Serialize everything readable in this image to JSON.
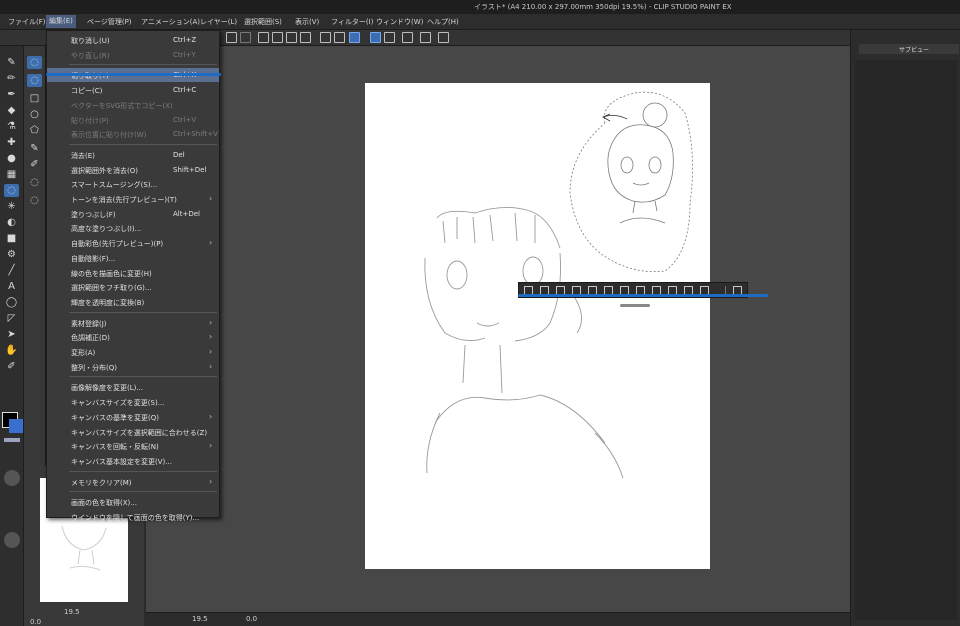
{
  "window": {
    "title": "イラスト* (A4 210.00 x 297.00mm 350dpi 19.5%) - CLIP STUDIO PAINT EX"
  },
  "menubar": {
    "items": [
      "ファイル(F)",
      "編集(E)",
      "ページ管理(P)",
      "アニメーション(A)",
      "レイヤー(L)",
      "選択範囲(S)",
      "表示(V)",
      "フィルター(I)",
      "ウィンドウ(W)",
      "ヘルプ(H)"
    ],
    "active": "編集(E)"
  },
  "edit_menu": {
    "items": [
      {
        "label": "取り消し(U)",
        "shortcut": "Ctrl+Z",
        "enabled": true
      },
      {
        "label": "やり直し(R)",
        "shortcut": "Ctrl+Y",
        "enabled": false
      },
      {
        "label": "切り取り(T)",
        "shortcut": "Ctrl+X",
        "enabled": true,
        "highlighted": true
      },
      {
        "label": "コピー(C)",
        "shortcut": "Ctrl+C",
        "enabled": true
      },
      {
        "label": "ベクターをSVG形式でコピー(X)",
        "shortcut": "",
        "enabled": false
      },
      {
        "label": "貼り付け(P)",
        "shortcut": "Ctrl+V",
        "enabled": false
      },
      {
        "label": "表示位置に貼り付け(W)",
        "shortcut": "Ctrl+Shift+V",
        "enabled": false
      },
      {
        "label": "消去(E)",
        "shortcut": "Del",
        "enabled": true
      },
      {
        "label": "選択範囲外を消去(O)",
        "shortcut": "Shift+Del",
        "enabled": true
      },
      {
        "label": "スマートスムージング(S)...",
        "shortcut": "",
        "enabled": true
      },
      {
        "label": "トーンを消去(先行プレビュー)(T)",
        "shortcut": "",
        "enabled": true,
        "submenu": true
      },
      {
        "label": "塗りつぶし(F)",
        "shortcut": "Alt+Del",
        "enabled": true
      },
      {
        "label": "高度な塗りつぶし(I)...",
        "shortcut": "",
        "enabled": true
      },
      {
        "label": "自動彩色(先行プレビュー)(P)",
        "shortcut": "",
        "enabled": true,
        "submenu": true
      },
      {
        "label": "自動陰影(F)...",
        "shortcut": "",
        "enabled": true
      },
      {
        "label": "線の色を描画色に変更(H)",
        "shortcut": "",
        "enabled": true
      },
      {
        "label": "選択範囲をフチ取り(G)...",
        "shortcut": "",
        "enabled": true
      },
      {
        "label": "輝度を透明度に変換(B)",
        "shortcut": "",
        "enabled": true
      },
      {
        "label": "素材登録(J)",
        "shortcut": "",
        "enabled": true,
        "submenu": true
      },
      {
        "label": "色調補正(D)",
        "shortcut": "",
        "enabled": true,
        "submenu": true
      },
      {
        "label": "変形(A)",
        "shortcut": "",
        "enabled": true,
        "submenu": true
      },
      {
        "label": "整列・分布(Q)",
        "shortcut": "",
        "enabled": true,
        "submenu": true
      },
      {
        "label": "画像解像度を変更(L)...",
        "shortcut": "",
        "enabled": true
      },
      {
        "label": "キャンバスサイズを変更(S)...",
        "shortcut": "",
        "enabled": true
      },
      {
        "label": "キャンバスの基準を変更(Q)",
        "shortcut": "",
        "enabled": true,
        "submenu": true
      },
      {
        "label": "キャンバスサイズを選択範囲に合わせる(Z)",
        "shortcut": "",
        "enabled": true
      },
      {
        "label": "キャンバスを回転・反転(N)",
        "shortcut": "",
        "enabled": true,
        "submenu": true
      },
      {
        "label": "キャンバス基本設定を変更(V)...",
        "shortcut": "",
        "enabled": true
      },
      {
        "label": "メモリをクリア(M)",
        "shortcut": "",
        "enabled": true,
        "submenu": true
      },
      {
        "label": "画面の色を取得(X)...",
        "shortcut": "",
        "enabled": true
      },
      {
        "label": "ウインドウを隠して画面の色を取得(Y)...",
        "shortcut": "",
        "enabled": true
      }
    ]
  },
  "statusbar": {
    "zoom": "19.5",
    "rotation": "0.0",
    "nav_zoom": "19.5",
    "nav_rotation": "0.0"
  },
  "right_panel": {
    "tab_label": "サブビュー"
  },
  "colors": {
    "accent": "#1e6bc4",
    "menu_highlight": "#5a6f92",
    "foreground": "#000000",
    "background_color": "#3a6fd0"
  }
}
